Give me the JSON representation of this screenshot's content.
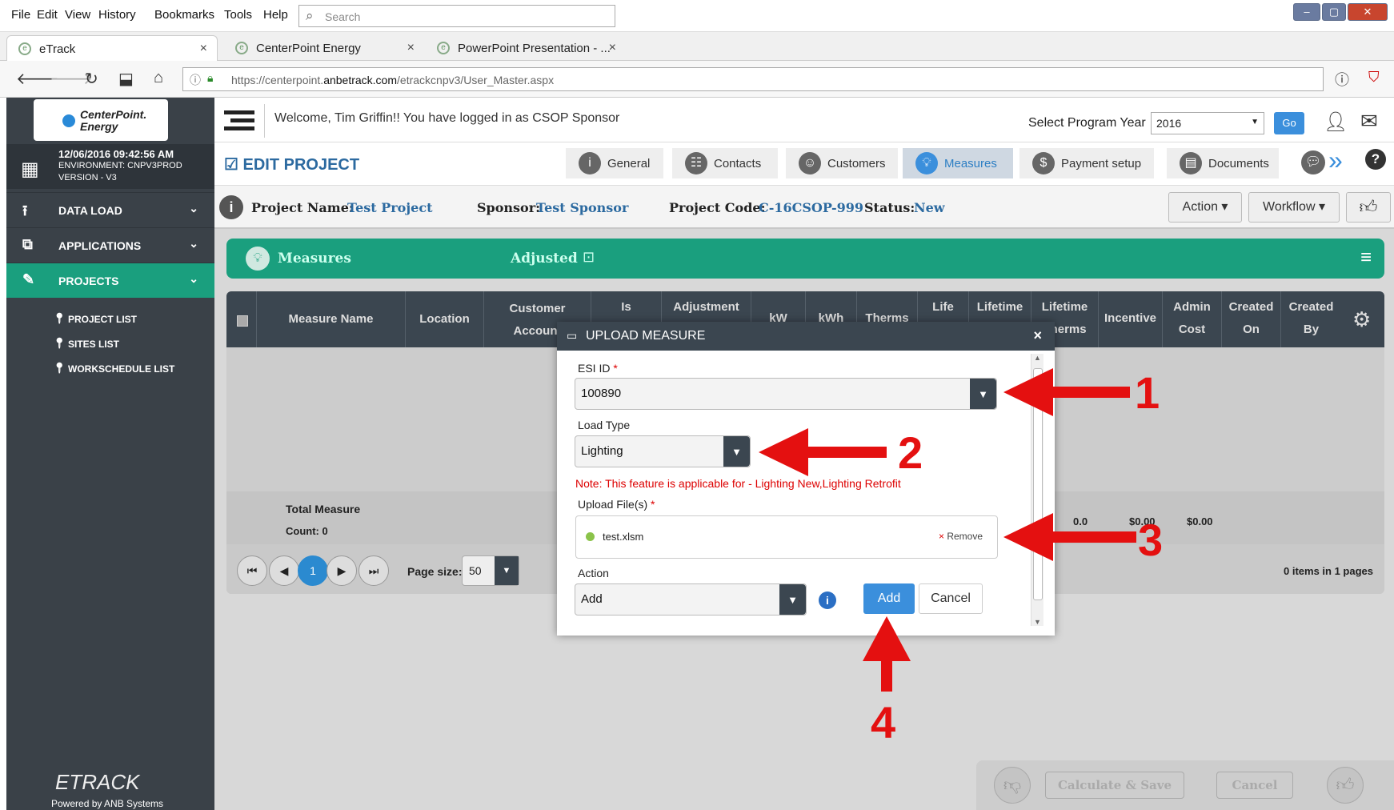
{
  "menu": [
    "File",
    "Edit",
    "View",
    "History",
    "Bookmarks",
    "Tools",
    "Help"
  ],
  "search_placeholder": "Search",
  "tabs": [
    {
      "label": "eTrack",
      "close": "×"
    },
    {
      "label": "CenterPoint Energy",
      "close": "×"
    },
    {
      "label": "PowerPoint Presentation - ...",
      "close": "×"
    }
  ],
  "url": {
    "prefix": "https://centerpoint.",
    "domain": "anbetrack.com",
    "path": "/etrackcnpv3/User_Master.aspx"
  },
  "logo": {
    "line1": "CenterPoint.",
    "line2": "Energy"
  },
  "sidebar": {
    "datetime": "12/06/2016 09:42:56 AM",
    "environment": "ENVIRONMENT: CNPV3PROD",
    "version": "VERSION - V3",
    "items": [
      {
        "label": "DATA LOAD"
      },
      {
        "label": "APPLICATIONS"
      },
      {
        "label": "PROJECTS"
      }
    ],
    "subitems": [
      "PROJECT LIST",
      "SITES LIST",
      "WORKSCHEDULE LIST"
    ],
    "footer_brand": "ETRACK",
    "footer_powered": "Powered by ANB Systems"
  },
  "header": {
    "welcome": "Welcome, Tim Griffin!! You have logged in as CSOP Sponsor",
    "year_label": "Select Program Year",
    "year_value": "2016",
    "go": "Go"
  },
  "project": {
    "title": "EDIT PROJECT",
    "tabs": [
      "General",
      "Contacts",
      "Customers",
      "Measures",
      "Payment setup",
      "Documents"
    ],
    "name_label": "Project Name:",
    "name_value": "Test Project",
    "sponsor_label": "Sponsor:",
    "sponsor_value": "Test Sponsor",
    "code_label": "Project Code:",
    "code_value": "C-16CSOP-999",
    "status_label": "Status:",
    "status_value": "New",
    "action_btn": "Action",
    "workflow_btn": "Workflow"
  },
  "grid": {
    "section_title": "Measures",
    "adjusted": "Adjusted",
    "columns": [
      "Measure Name",
      "Location",
      "Customer Account",
      "Is",
      "Adjustment",
      "kW",
      "kWh",
      "Therms",
      "Life",
      "Lifetime",
      "Lifetime Therms",
      "Incentive",
      "Admin Cost",
      "Created On",
      "Created By"
    ],
    "total_label": "Total Measure",
    "count_label": "Count: 0",
    "totals": [
      "0.0",
      "$0.00",
      "$0.00"
    ],
    "page_current": "1",
    "page_size_label": "Page size:",
    "page_size": "50",
    "items_info": "0 items in 1 pages"
  },
  "modal": {
    "title": "UPLOAD MEASURE",
    "esi_label": "ESI ID",
    "esi_value": "100890",
    "load_label": "Load Type",
    "load_value": "Lighting",
    "note": "Note: This feature is applicable for - Lighting New,Lighting Retrofit",
    "upload_label": "Upload File(s)",
    "file_name": "test.xlsm",
    "remove": "Remove",
    "action_label": "Action",
    "action_value": "Add",
    "add_btn": "Add",
    "cancel_btn": "Cancel"
  },
  "annotations": [
    "1",
    "2",
    "3",
    "4"
  ],
  "bottom": {
    "calc": "Calculate & Save",
    "cancel": "Cancel"
  }
}
